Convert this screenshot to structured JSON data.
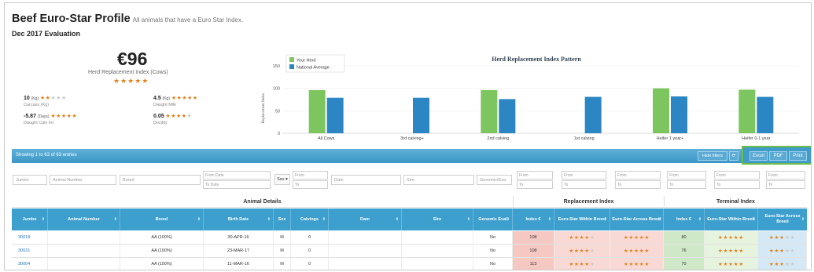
{
  "header": {
    "title": "Beef Euro-Star Profile",
    "subtitle": "All animals that have a Euro Star Index.",
    "evaluation": "Dec 2017 Evaluation"
  },
  "summary": {
    "value": "€96",
    "label": "Herd Replacement Index (Cows)",
    "stars": "★★★★★",
    "traits": [
      {
        "value": "10",
        "unit": "(Kg)",
        "stars_on": "★★",
        "stars_off": "★★★",
        "label": "Carcass (Kg)"
      },
      {
        "value": "4.5",
        "unit": "(Kg)",
        "stars_on": "★★★★★",
        "stars_off": "",
        "label": "Daught Milk"
      },
      {
        "value": "-5.87",
        "unit": "(Days)",
        "stars_on": "★★★★★",
        "stars_off": "",
        "label": "Daught Calv Int"
      },
      {
        "value": "0.05",
        "unit": "",
        "stars_on": "★★★★",
        "stars_off": "★",
        "label": "Docility"
      }
    ]
  },
  "chart_data": {
    "type": "bar",
    "title": "Herd Replacement Index Pattern",
    "ylabel": "Replacement Index",
    "ylim": [
      0,
      150
    ],
    "yticks": [
      "0",
      "50",
      "100",
      "150"
    ],
    "categories": [
      "All Cows",
      "3rd calving+",
      "2nd calving",
      "1st calving",
      "Heifer 1 year+",
      "Heifer 0-1 year"
    ],
    "series": [
      {
        "name": "Your Herd",
        "color": "#7cc55f",
        "values": [
          96,
          null,
          96,
          null,
          100,
          97
        ]
      },
      {
        "name": "National Average",
        "color": "#2d86c4",
        "values": [
          79,
          79,
          76,
          81,
          82,
          81
        ]
      }
    ]
  },
  "toolbar": {
    "showing": "Showing 1 to 63 of 63 entries",
    "hide_filters": "Hide filters",
    "refresh": "⟳",
    "excel": "Excel",
    "pdf": "PDF",
    "print": "Print"
  },
  "filters": {
    "jumbo": "Jumbo",
    "animal_number": "Animal Number",
    "breed": "Breed",
    "from_date": "From Date",
    "to_date": "To Date",
    "sex": "Sex ▾",
    "from": "From",
    "to": "To",
    "dam": "Dam",
    "sire": "Sire",
    "genomic": "Genomic/Eva"
  },
  "groups": {
    "animal": "Animal Details",
    "replacement": "Replacement Index",
    "terminal": "Terminal Index"
  },
  "columns": [
    "Jumbo",
    "Animal Number",
    "Breed",
    "Birth Date",
    "Sex",
    "Calvings",
    "Dam",
    "Sire",
    "Genomic Eval",
    "Index €",
    "Euro-Star Within Breed",
    "Euro-Star Across Breed",
    "Index €",
    "Euro-Star Within Breed",
    "Euro-Star Across Breed"
  ],
  "rows": [
    {
      "jumbo": "30018",
      "animal": "",
      "breed": "AA (100%)",
      "birth": "30-APR-16",
      "sex": "M",
      "calvings": "0",
      "dam": "",
      "sire": "",
      "genomic": "No",
      "r_index": "108",
      "r_within_on": "★★★★",
      "r_within_off": "★",
      "r_across_on": "★★★★★",
      "r_across_off": "",
      "t_index": "80",
      "t_within_on": "★★★★★",
      "t_within_off": "",
      "t_across_on": "★★★",
      "t_across_off": "★★"
    },
    {
      "jumbo": "30031",
      "animal": "",
      "breed": "AA (100%)",
      "birth": "23-MAR-17",
      "sex": "M",
      "calvings": "0",
      "dam": "",
      "sire": "",
      "genomic": "No",
      "r_index": "108",
      "r_within_on": "★★★★",
      "r_within_off": "★",
      "r_across_on": "★★★★★",
      "r_across_off": "",
      "t_index": "76",
      "t_within_on": "★★★★★",
      "t_within_off": "",
      "t_across_on": "★★★",
      "t_across_off": "★★"
    },
    {
      "jumbo": "30004",
      "animal": "",
      "breed": "AA (100%)",
      "birth": "11-MAR-16",
      "sex": "M",
      "calvings": "0",
      "dam": "",
      "sire": "",
      "genomic": "No",
      "r_index": "113",
      "r_within_on": "★★★★",
      "r_within_off": "★",
      "r_across_on": "★★★★★",
      "r_across_off": "",
      "t_index": "70",
      "t_within_on": "★★★★★",
      "t_within_off": "",
      "t_across_on": "★★★",
      "t_across_off": "★★"
    }
  ]
}
